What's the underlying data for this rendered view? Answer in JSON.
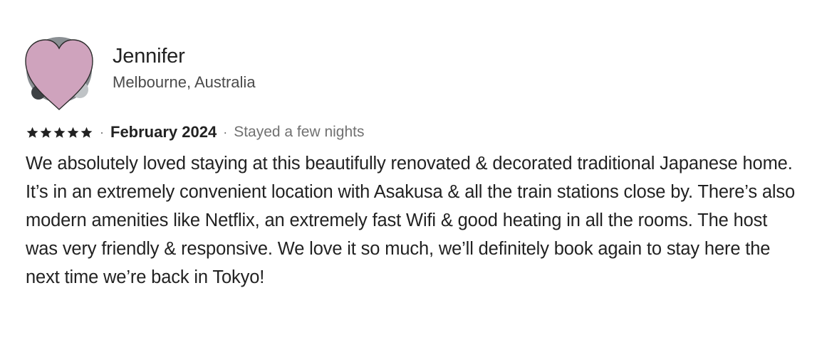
{
  "reviewer": {
    "name": "Jennifer",
    "location": "Melbourne, Australia"
  },
  "review": {
    "rating": 5,
    "rating_max": 5,
    "date": "February 2024",
    "separator": "·",
    "stay_length": "Stayed a few nights",
    "text": "We absolutely loved staying at this beautifully renovated & decorated traditional Japanese home. It’s in an extremely convenient location with Asakusa & all the train stations close by. There’s also modern amenities like Netflix, an extremely fast Wifi & good heating in all the rooms. The host was very friendly & responsive. We love it so much, we’ll definitely book again to stay here the next time we’re back in Tokyo!"
  },
  "icons": {
    "avatar": "heart-shaped-avatar",
    "star": "star-icon"
  },
  "colors": {
    "avatar_heart": "#cfa3bd",
    "star": "#222222",
    "text": "#222222",
    "muted": "#717171"
  }
}
